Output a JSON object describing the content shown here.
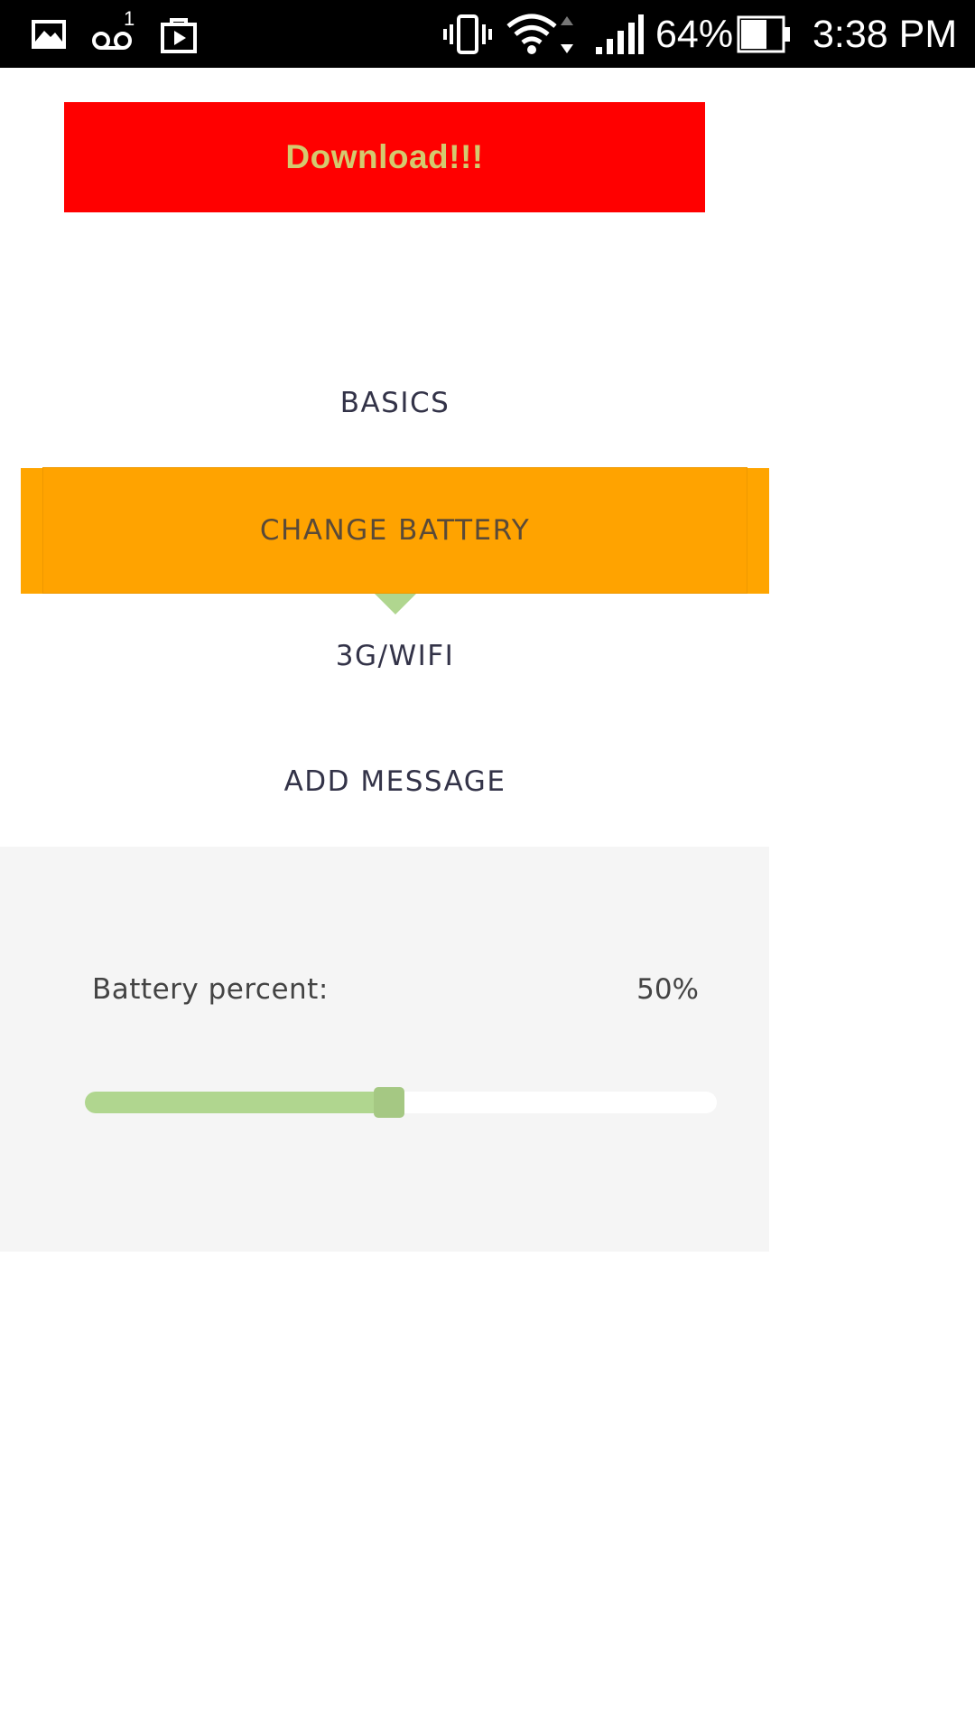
{
  "status_bar": {
    "icons_left": [
      "gallery-icon",
      "voicemail-icon",
      "shopping-bag-icon"
    ],
    "voicemail_count": "1",
    "icons_right": [
      "vibrate-icon",
      "wifi-icon",
      "signal-icon",
      "battery-icon"
    ],
    "battery_percent": "64%",
    "time": "3:38 PM"
  },
  "download_button": {
    "label": "Download!!!",
    "bg_color": "#ff0000",
    "text_color": "#d4c96f"
  },
  "menu": {
    "items": [
      {
        "label": "BASICS"
      },
      {
        "label": "CHANGE BATTERY",
        "selected": true
      },
      {
        "label": "3G/WIFI"
      },
      {
        "label": "ADD MESSAGE"
      }
    ],
    "selected_color": "#ffa500"
  },
  "battery_panel": {
    "label": "Battery percent:",
    "value_text": "50%",
    "slider_value": 0.5,
    "slider_fill_color": "#b0d68f"
  }
}
